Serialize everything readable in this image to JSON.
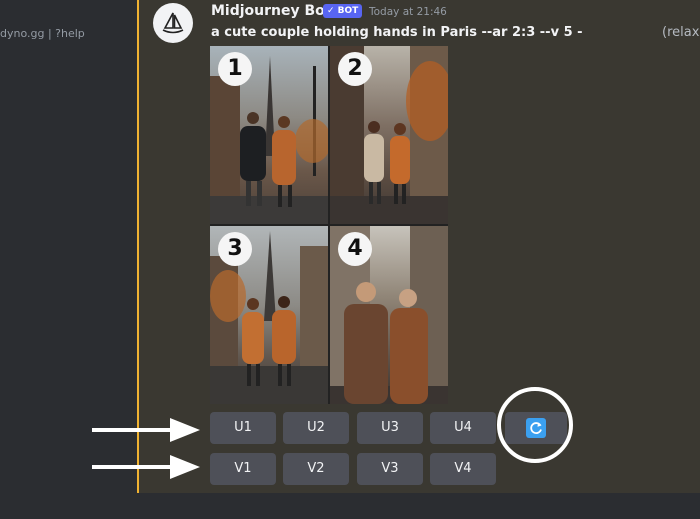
{
  "sidebar": {
    "server_text": "dyno.gg | ?help"
  },
  "message": {
    "username": "Midjourney Bot",
    "badge": "✓ BOT",
    "timestamp": "Today at 21:46",
    "prompt": "a cute couple holding hands in Paris --ar 2:3 --v 5 -",
    "prompt_tail": "(relax"
  },
  "grid": {
    "labels": [
      "1",
      "2",
      "3",
      "4"
    ]
  },
  "buttons": {
    "upscale": [
      "U1",
      "U2",
      "U3",
      "U4"
    ],
    "variation": [
      "V1",
      "V2",
      "V3",
      "V4"
    ]
  },
  "icons": {
    "avatar": "sailboat-icon",
    "reroll": "refresh-icon",
    "arrow": "arrow-right-icon"
  },
  "colors": {
    "accent_bar": "#f0b232",
    "bot_badge": "#5865f2",
    "button": "#4e5058",
    "reroll_icon": "#3ba0f0"
  }
}
